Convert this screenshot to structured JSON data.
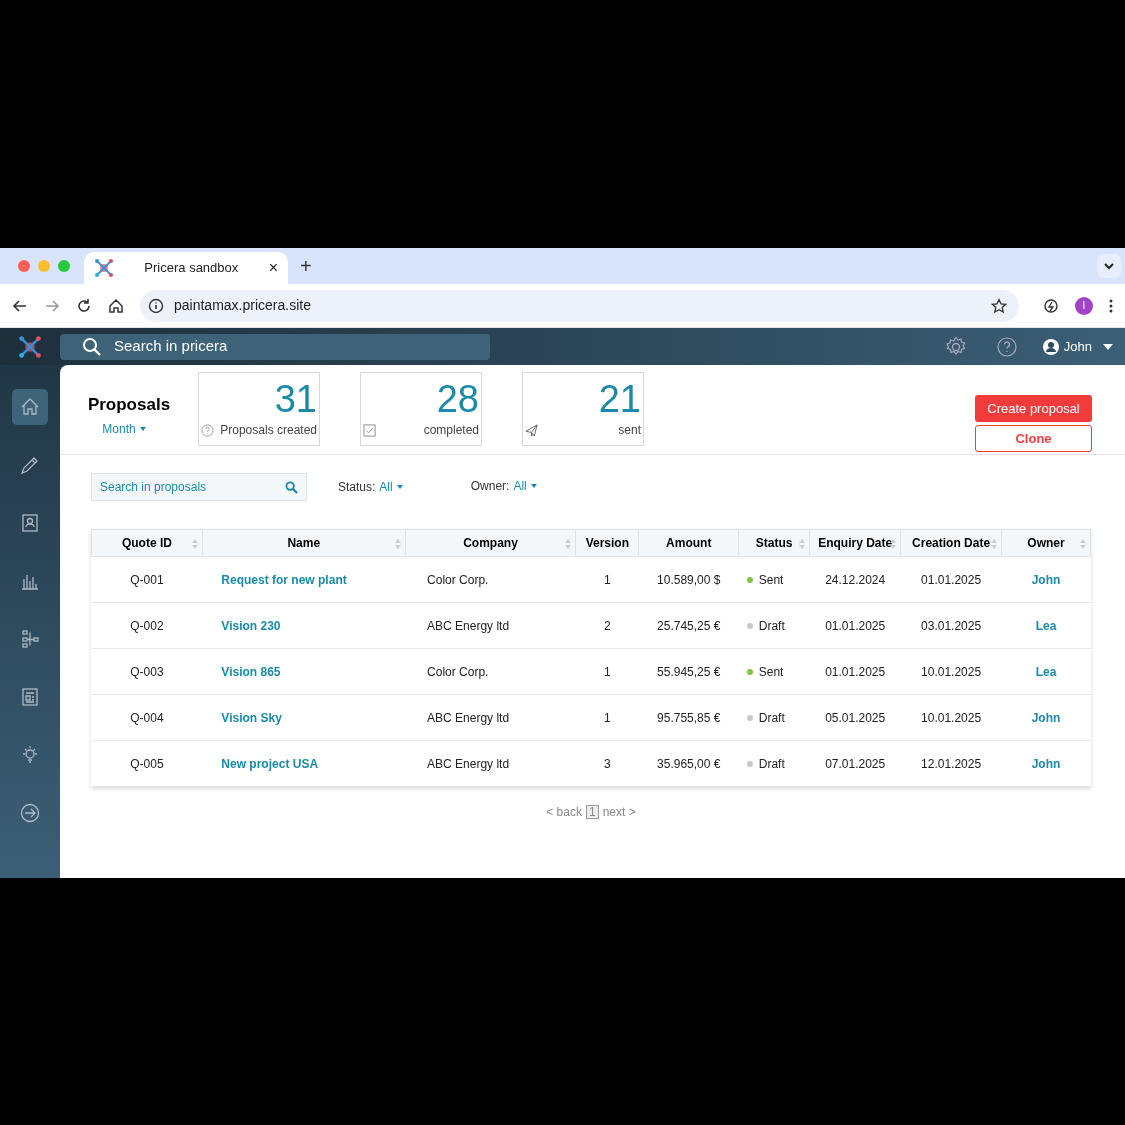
{
  "browser": {
    "tab_title": "Pricera sandbox",
    "tab_close": "×",
    "new_tab": "+",
    "url": "paintamax.pricera.site",
    "profile_initial": "I"
  },
  "app": {
    "search_placeholder": "Search in pricera",
    "user": "John"
  },
  "sidebar": {
    "items": [
      {
        "kind": "home",
        "selected": true
      },
      {
        "kind": "pen",
        "selected": false
      },
      {
        "kind": "contact",
        "selected": false
      },
      {
        "kind": "chart",
        "selected": false
      },
      {
        "kind": "tree",
        "selected": false
      },
      {
        "kind": "document",
        "selected": false
      },
      {
        "kind": "bulb",
        "selected": false
      },
      {
        "kind": "logout",
        "selected": false
      }
    ]
  },
  "header": {
    "title": "Proposals",
    "period": "Month"
  },
  "stats": [
    {
      "kind": "help",
      "value": "31",
      "label": "Proposals created"
    },
    {
      "kind": "check",
      "value": "28",
      "label": "completed"
    },
    {
      "kind": "send",
      "value": "21",
      "label": "sent"
    }
  ],
  "actions": [
    "Create proposal",
    "Clone"
  ],
  "filters": {
    "search_placeholder": "Search in proposals",
    "status_label": "Status:",
    "status_value": "All",
    "owner_label": "Owner:",
    "owner_value": "All"
  },
  "table": {
    "columns": [
      {
        "label": "Quote ID",
        "sortable": true
      },
      {
        "label": "Name",
        "sortable": true
      },
      {
        "label": "Company",
        "sortable": true
      },
      {
        "label": "Version",
        "sortable": false
      },
      {
        "label": "Amount",
        "sortable": false
      },
      {
        "label": "Status",
        "sortable": true
      },
      {
        "label": "Enquiry Date",
        "sortable": true
      },
      {
        "label": "Creation Date",
        "sortable": true
      },
      {
        "label": "Owner",
        "sortable": true
      }
    ],
    "rows": [
      {
        "id": "Q-001",
        "name": "Request for new plant",
        "company": "Color Corp.",
        "version": "1",
        "amount": "10.589,00 $",
        "status": "Sent",
        "color": "#7cc443",
        "enquiry": "24.12.2024",
        "created": "01.01.2025",
        "owner": "John"
      },
      {
        "id": "Q-002",
        "name": "Vision 230",
        "company": "ABC Energy ltd",
        "version": "2",
        "amount": "25.745,25 €",
        "status": "Draft",
        "color": "#c8c8c8",
        "enquiry": "01.01.2025",
        "created": "03.01.2025",
        "owner": "Lea"
      },
      {
        "id": "Q-003",
        "name": "Vision 865",
        "company": "Color Corp.",
        "version": "1",
        "amount": "55.945,25 €",
        "status": "Sent",
        "color": "#7cc443",
        "enquiry": "01.01.2025",
        "created": "10.01.2025",
        "owner": "Lea"
      },
      {
        "id": "Q-004",
        "name": "Vision Sky",
        "company": "ABC Energy ltd",
        "version": "1",
        "amount": "95.755,85 €",
        "status": "Draft",
        "color": "#c8c8c8",
        "enquiry": "05.01.2025",
        "created": "10.01.2025",
        "owner": "John"
      },
      {
        "id": "Q-005",
        "name": "New project USA",
        "company": "ABC Energy ltd",
        "version": "3",
        "amount": "35.965,00 €",
        "status": "Draft",
        "color": "#c8c8c8",
        "enquiry": "07.01.2025",
        "created": "12.01.2025",
        "owner": "John"
      }
    ]
  },
  "pagination": {
    "back": "< back",
    "page": "1",
    "next": "next >"
  }
}
